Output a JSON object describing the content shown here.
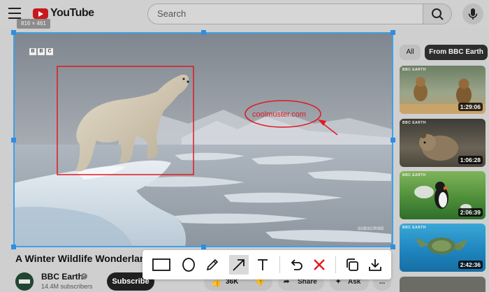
{
  "header": {
    "logo_text": "YouTube",
    "search_placeholder": "Search"
  },
  "player": {
    "size_label": "816 × 461",
    "watermark_letters": [
      "B",
      "B",
      "C"
    ],
    "subscribe_watermark": "SUBSCRIBE",
    "annotation_text": "coolmuster.com"
  },
  "filters": {
    "all_label": "All",
    "bbc_label": "From BBC Earth"
  },
  "related": [
    {
      "badge": "BBC EARTH",
      "duration": "1:29:06"
    },
    {
      "badge": "BBC EARTH",
      "duration": "1:06:28"
    },
    {
      "badge": "BBC EARTH",
      "duration": "2:06:39"
    },
    {
      "badge": "BBC EARTH",
      "duration": "2:42:36"
    }
  ],
  "video": {
    "title": "A Winter Wildlife Wonderland",
    "channel": "BBC Earth",
    "subscribers": "14.4M subscribers",
    "subscribe_label": "Subscribe",
    "likes": "36K",
    "share_label": "Share",
    "ask_label": "Ask",
    "more_label": "..."
  },
  "colors": {
    "capture_border": "#3fa0e8",
    "annotation_red": "#e0191f",
    "toolbar_bg": "#ffffff"
  },
  "toolbar_icons": [
    "rectangle-icon",
    "ellipse-icon",
    "pencil-icon",
    "arrow-icon",
    "text-icon",
    "undo-icon",
    "close-icon",
    "copy-icon",
    "download-icon"
  ]
}
